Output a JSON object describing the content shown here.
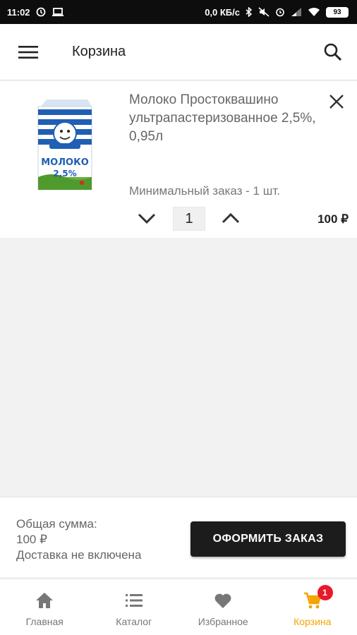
{
  "status_bar": {
    "time": "11:02",
    "network_speed": "0,0 КБ/с",
    "battery": "93"
  },
  "app_bar": {
    "title": "Корзина",
    "menu_icon": "menu-icon",
    "search_icon": "search-icon"
  },
  "cart": {
    "items": [
      {
        "name": "Молоко Простоквашино ультрапастеризованное 2,5%, 0,95л",
        "image_label_top": "МОЛОКО",
        "image_label_fat": "2,5%",
        "min_order": "Минимальный заказ - 1 шт.",
        "quantity": "1",
        "price": "100 ₽"
      }
    ]
  },
  "summary": {
    "total_label": "Общая сумма:",
    "total_value": "100 ₽",
    "delivery_note": "Доставка не включена",
    "checkout_label": "ОФОРМИТЬ ЗАКАЗ"
  },
  "bottom_nav": {
    "items": [
      {
        "label": "Главная",
        "icon": "home-icon"
      },
      {
        "label": "Каталог",
        "icon": "list-icon"
      },
      {
        "label": "Избранное",
        "icon": "heart-icon"
      },
      {
        "label": "Корзина",
        "icon": "cart-icon",
        "badge": "1",
        "active": true
      }
    ]
  },
  "colors": {
    "accent": "#f5a300",
    "badge": "#e8192c",
    "button": "#1c1c1c"
  }
}
